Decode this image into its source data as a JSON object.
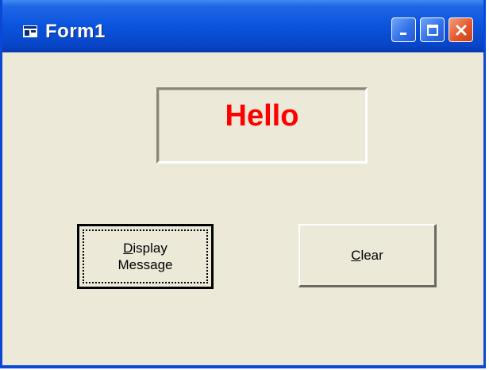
{
  "window": {
    "title": "Form1",
    "controls": {
      "minimize_icon": "minimize-icon",
      "maximize_icon": "maximize-icon",
      "close_icon": "close-icon"
    }
  },
  "form": {
    "label": {
      "text": "Hello",
      "color": "#ff0000"
    },
    "display_button": {
      "access_key": "D",
      "rest_line1": "isplay",
      "line2": "Message"
    },
    "clear_button": {
      "access_key": "C",
      "rest": "lear"
    }
  },
  "colors": {
    "titlebar": "#0a53dd",
    "face": "#ece9d8",
    "close": "#e5582d"
  }
}
